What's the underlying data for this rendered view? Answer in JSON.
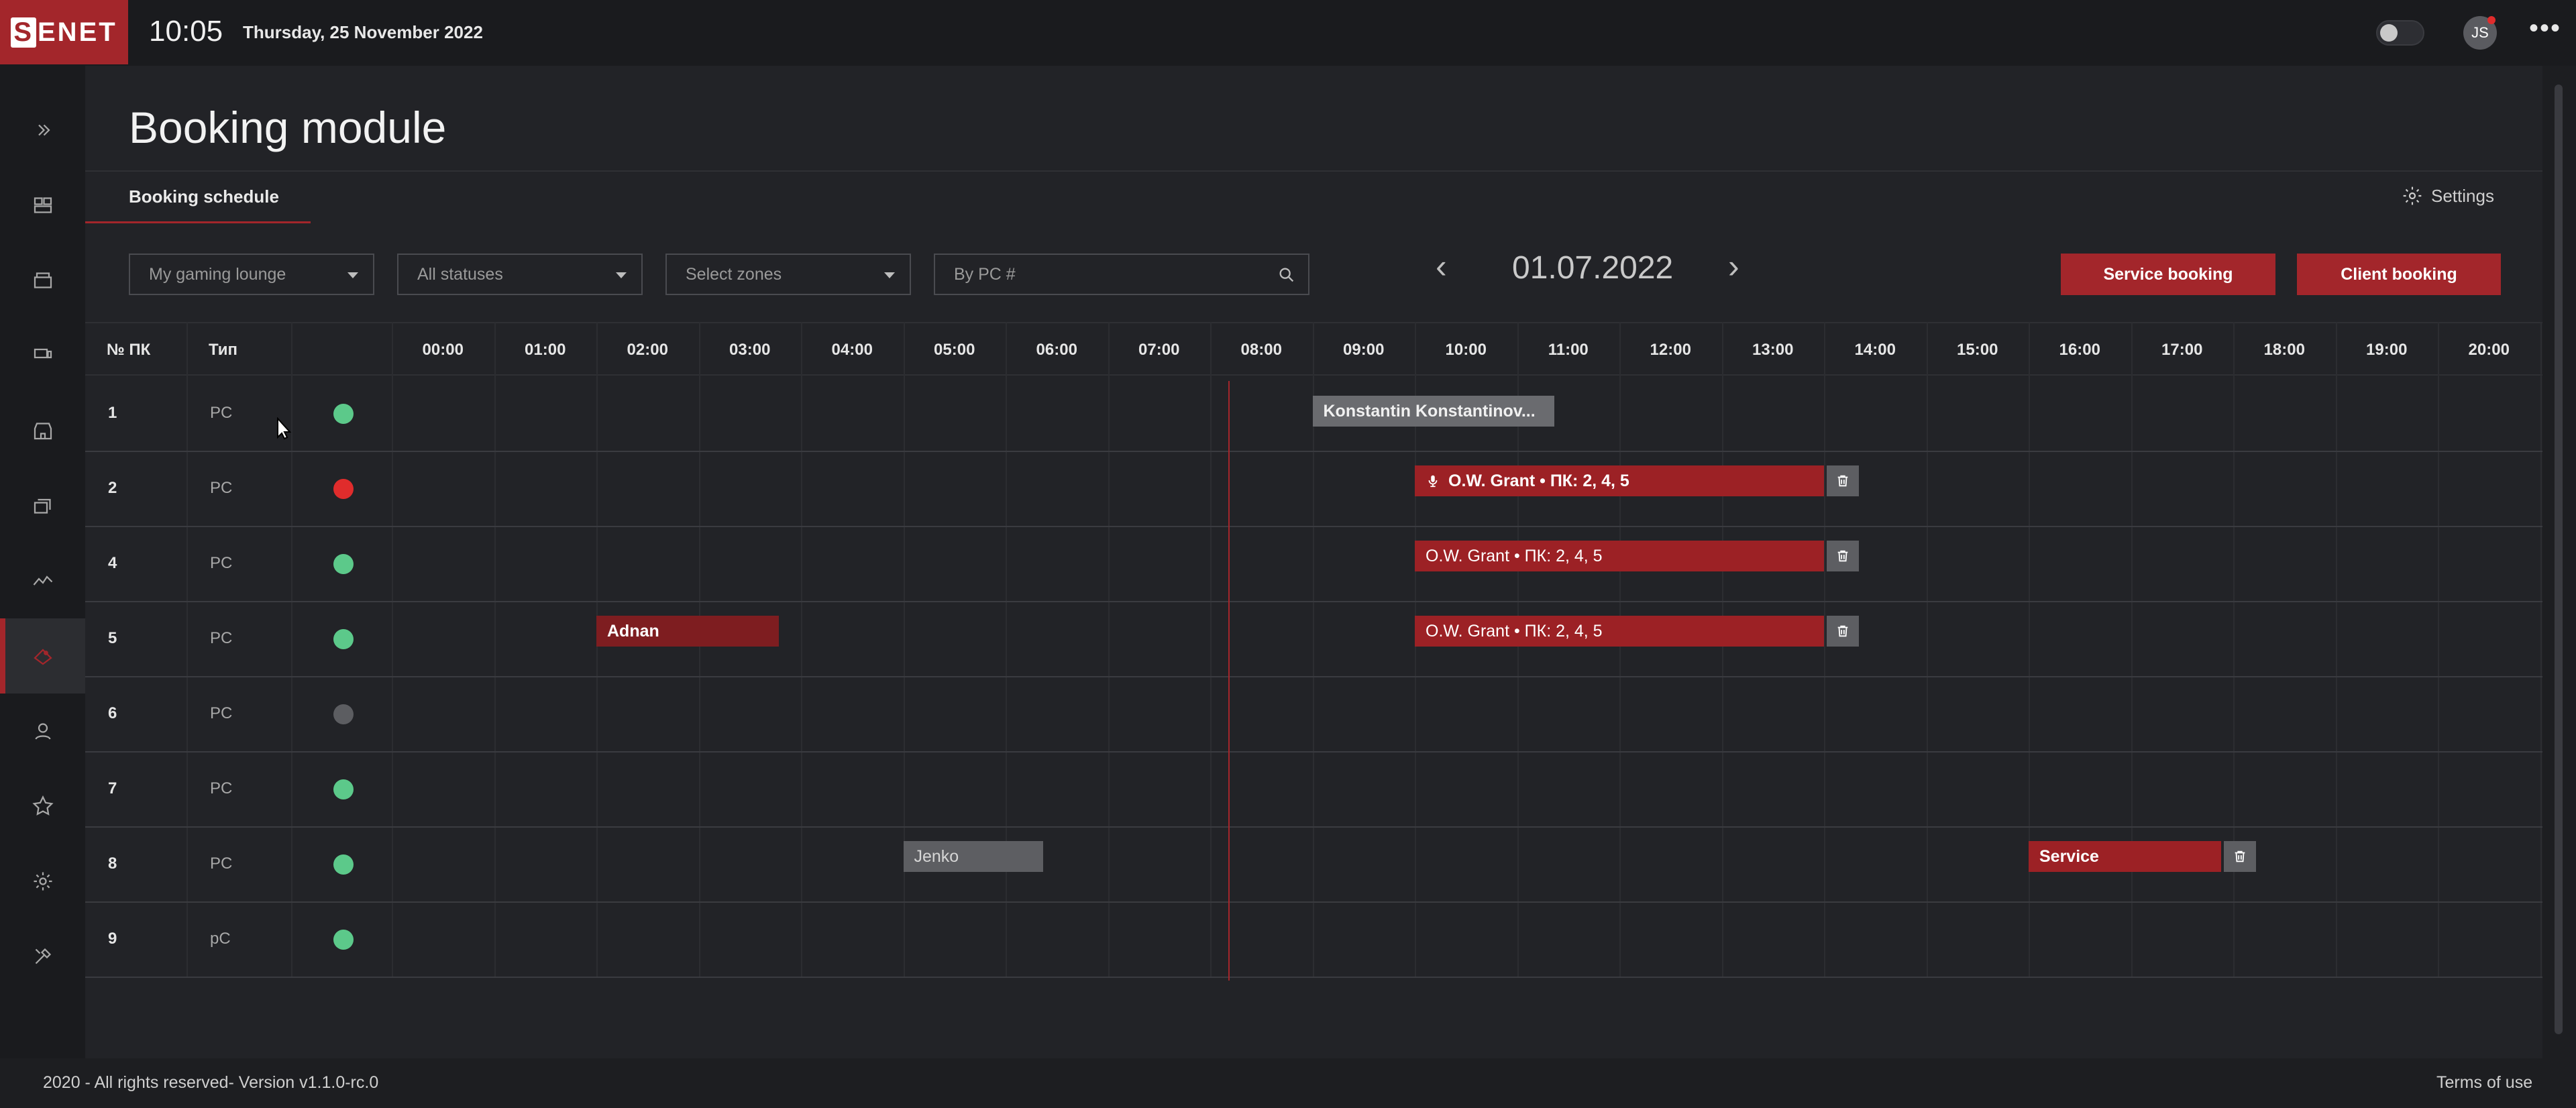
{
  "app": {
    "logo": "SENET",
    "logo_s": "S",
    "logo_rest": "ENET"
  },
  "header": {
    "time": "10:05",
    "date": "Thursday, 25 November 2022",
    "user_initials": "JS"
  },
  "sidebar": {
    "items": [
      "expand-icon",
      "devices-icon",
      "shop-icon",
      "pc-icon",
      "store-icon",
      "layers-icon",
      "stats-icon",
      "booking-icon",
      "users-icon",
      "star-icon",
      "settings-icon",
      "tools-icon"
    ],
    "active_index": 7
  },
  "page": {
    "title": "Booking module",
    "tab": "Booking schedule",
    "settings_label": "Settings"
  },
  "filters": {
    "lounge": "My gaming lounge",
    "statuses": "All statuses",
    "zones": "Select zones",
    "search_placeholder": "By PC #"
  },
  "date_nav": {
    "date": "01.07.2022"
  },
  "buttons": {
    "service_booking": "Service booking",
    "client_booking": "Client booking"
  },
  "grid": {
    "col_pc": "№ ПК",
    "col_type": "Тип",
    "hours": [
      "00:00",
      "01:00",
      "02:00",
      "03:00",
      "04:00",
      "05:00",
      "06:00",
      "07:00",
      "08:00",
      "09:00",
      "10:00",
      "11:00",
      "12:00",
      "13:00",
      "14:00",
      "15:00",
      "16:00",
      "17:00",
      "18:00",
      "19:00",
      "20:00"
    ],
    "rows": [
      {
        "num": "1",
        "type": "PC",
        "status": "online"
      },
      {
        "num": "2",
        "type": "PC",
        "status": "busy"
      },
      {
        "num": "4",
        "type": "PC",
        "status": "online"
      },
      {
        "num": "5",
        "type": "PC",
        "status": "online"
      },
      {
        "num": "6",
        "type": "PC",
        "status": "offline"
      },
      {
        "num": "7",
        "type": "PC",
        "status": "online"
      },
      {
        "num": "8",
        "type": "PC",
        "status": "online"
      },
      {
        "num": "9",
        "type": "pC",
        "status": "online"
      }
    ],
    "bookings": [
      {
        "row": 0,
        "label": "Konstantin Konstantinov...",
        "start": "09:00",
        "end": "11:22",
        "style": "gray-bold",
        "trash": false
      },
      {
        "row": 1,
        "label": "O.W. Grant • ПК: 2, 4, 5",
        "start": "10:00",
        "end": "14:00",
        "style": "red",
        "trash": true,
        "icon": "mic-icon"
      },
      {
        "row": 2,
        "label": "O.W. Grant • ПК: 2, 4, 5",
        "start": "10:00",
        "end": "14:00",
        "style": "red",
        "trash": true
      },
      {
        "row": 3,
        "label": "O.W. Grant • ПК: 2, 4, 5",
        "start": "10:00",
        "end": "14:00",
        "style": "red",
        "trash": true
      },
      {
        "row": 3,
        "label": "Adnan",
        "start": "02:00",
        "end": "03:47",
        "style": "darkred",
        "trash": false
      },
      {
        "row": 6,
        "label": "Jenko",
        "start": "05:00",
        "end": "06:22",
        "style": "gray",
        "trash": false
      },
      {
        "row": 6,
        "label": "Service",
        "start": "16:00",
        "end": "17:53",
        "style": "red-bold",
        "trash": true
      }
    ]
  },
  "colors": {
    "accent": "#a3262b",
    "online": "#5cc98a",
    "busy": "#e02c2c",
    "offline": "#5c5d61"
  },
  "footer": {
    "copyright": "2020 - All rights reserved- Version v1.1.0-rc.0",
    "terms": "Terms of use"
  }
}
